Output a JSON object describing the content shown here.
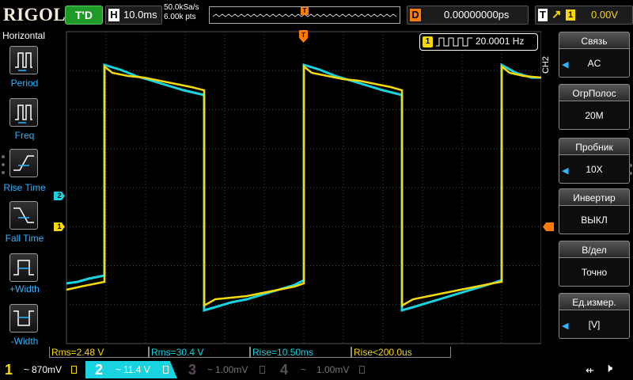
{
  "header": {
    "logo": "RIGOL",
    "run_status": "T'D",
    "horizontal": {
      "label": "H",
      "timebase": "10.0ms"
    },
    "sample_rate": "50.0kSa/s",
    "memory_depth": "6.00k pts",
    "trigger_pos_marker": "T",
    "delay": {
      "label": "D",
      "value": "0.00000000ps"
    },
    "trigger": {
      "label": "T",
      "edge_icon": "rising-edge-icon",
      "source": "1",
      "level": "0.00V"
    }
  },
  "left_menu": {
    "title": "Horizontal",
    "items": [
      {
        "label": "Period",
        "icon": "period-icon"
      },
      {
        "label": "Freq",
        "icon": "freq-icon"
      },
      {
        "label": "Rise Time",
        "icon": "rise-time-icon"
      },
      {
        "label": "Fall Time",
        "icon": "fall-time-icon"
      },
      {
        "label": "+Width",
        "icon": "pos-width-icon"
      },
      {
        "label": "-Width",
        "icon": "neg-width-icon"
      }
    ]
  },
  "display": {
    "ch1_marker": "1",
    "ch2_marker": "2",
    "trigger_marker": "T",
    "frequency_counter": {
      "channel": "1",
      "value": "20.0001 Hz"
    }
  },
  "measurements": [
    {
      "text": "Rms=2.48 V",
      "channel": "1"
    },
    {
      "text": "Rms=30.4 V",
      "channel": "2"
    },
    {
      "text": "Rise=10.50ms",
      "channel": "2"
    },
    {
      "text": "Rise<200.0us",
      "channel": "1"
    }
  ],
  "right_menu": {
    "channel_tab": "CH2",
    "items": [
      {
        "title": "Связь",
        "value": "AC",
        "has_arrow": true
      },
      {
        "title": "ОгрПолос",
        "value": "20M",
        "has_arrow": false
      },
      {
        "title": "Пробник",
        "value": "10X",
        "has_arrow": true
      },
      {
        "title": "Инвертир",
        "value": "ВЫКЛ",
        "has_arrow": false
      },
      {
        "title": "В/дел",
        "value": "Точно",
        "has_arrow": false
      },
      {
        "title": "Ед.измер.",
        "value": "[V]",
        "has_arrow": true
      }
    ]
  },
  "channels": [
    {
      "num": "1",
      "coupling": "~",
      "scale": "870mV",
      "color": "#f5d90a",
      "active": true
    },
    {
      "num": "2",
      "coupling": "~",
      "scale": "11.4 V",
      "color": "#19d3e0",
      "active": true,
      "selected": true
    },
    {
      "num": "3",
      "coupling": "~",
      "scale": "1.00mV",
      "color": "#e040e0",
      "active": false
    },
    {
      "num": "4",
      "coupling": "~",
      "scale": "1.00mV",
      "color": "#2a7bff",
      "active": false
    }
  ],
  "colors": {
    "ch1": "#f5d90a",
    "ch2": "#19d3e0",
    "trigger": "#ff7a00",
    "menu_accent": "#2fb5ff"
  }
}
